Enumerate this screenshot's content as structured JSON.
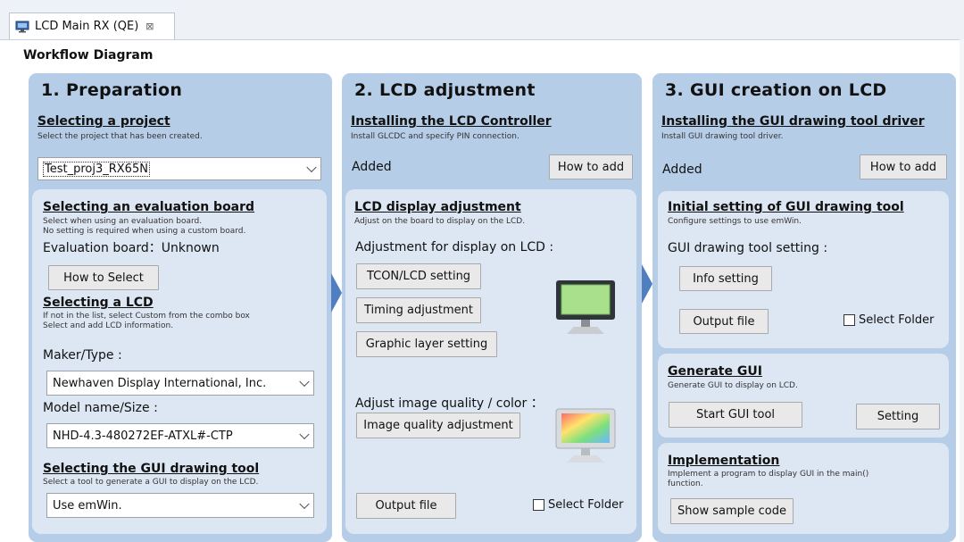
{
  "tab": {
    "title": "LCD Main RX (QE)",
    "close_glyph": "⊠"
  },
  "workflow": {
    "label": "Workflow Diagram"
  },
  "prep": {
    "title": "1. Preparation",
    "project": {
      "heading": "Selecting a project",
      "desc": "Select the project that has been created.",
      "value": "Test_proj3_RX65N"
    },
    "board": {
      "heading": "Selecting an evaluation board",
      "desc1": "Select when using an evaluation board.",
      "desc2": "No setting is required when using a custom board.",
      "status_label": "Evaluation board：",
      "status_value": "Unknown",
      "how_button": "How to Select"
    },
    "lcd": {
      "heading": "Selecting a LCD",
      "desc1": "If not in the list, select Custom from the combo box",
      "desc2": "Select and add LCD information.",
      "maker_label": "Maker/Type :",
      "maker_value": "Newhaven Display International, Inc.",
      "model_label": "Model name/Size :",
      "model_value": "NHD-4.3-480272EF-ATXL#-CTP"
    },
    "gui": {
      "heading": "Selecting the GUI drawing tool",
      "desc": "Select a tool to generate a GUI to display on the LCD.",
      "value": "Use emWin."
    }
  },
  "lcdadj": {
    "title": "2. LCD adjustment",
    "controller": {
      "heading": "Installing the LCD Controller",
      "desc": "Install GLCDC and specify PIN connection.",
      "status": "Added",
      "how_button": "How to add"
    },
    "display": {
      "heading": "LCD display adjustment",
      "desc": "Adjust on the board to display on the LCD.",
      "adj_label": "Adjustment for display on LCD :",
      "tcon_button": "TCON/LCD setting",
      "timing_button": "Timing adjustment",
      "graphic_button": "Graphic layer setting",
      "quality_label": "Adjust image quality / color ：",
      "quality_button": "Image quality adjustment",
      "output_button": "Output file",
      "select_folder": "Select Folder"
    }
  },
  "guicr": {
    "title": "3. GUI creation on LCD",
    "driver": {
      "heading": "Installing the GUI drawing tool driver",
      "desc": "Install GUI drawing tool driver.",
      "status": "Added",
      "how_button": "How to add"
    },
    "initial": {
      "heading": "Initial setting of GUI drawing tool",
      "desc": "Configure settings to use emWin.",
      "setting_label": "GUI drawing tool setting :",
      "info_button": "Info setting",
      "output_button": "Output file",
      "select_folder": "Select Folder"
    },
    "generate": {
      "heading": "Generate GUI",
      "desc": "Generate GUI to display on LCD.",
      "start_button": "Start GUI tool",
      "setting_button": "Setting"
    },
    "impl": {
      "heading": "Implementation",
      "desc1": "Implement a program to display GUI in the main()",
      "desc2": "function.",
      "show_button": "Show sample code"
    }
  },
  "colors": {
    "panel_bg": "#b6cde8",
    "inner_bg": "#dde7f4",
    "arrow": "#4f7fc0"
  }
}
